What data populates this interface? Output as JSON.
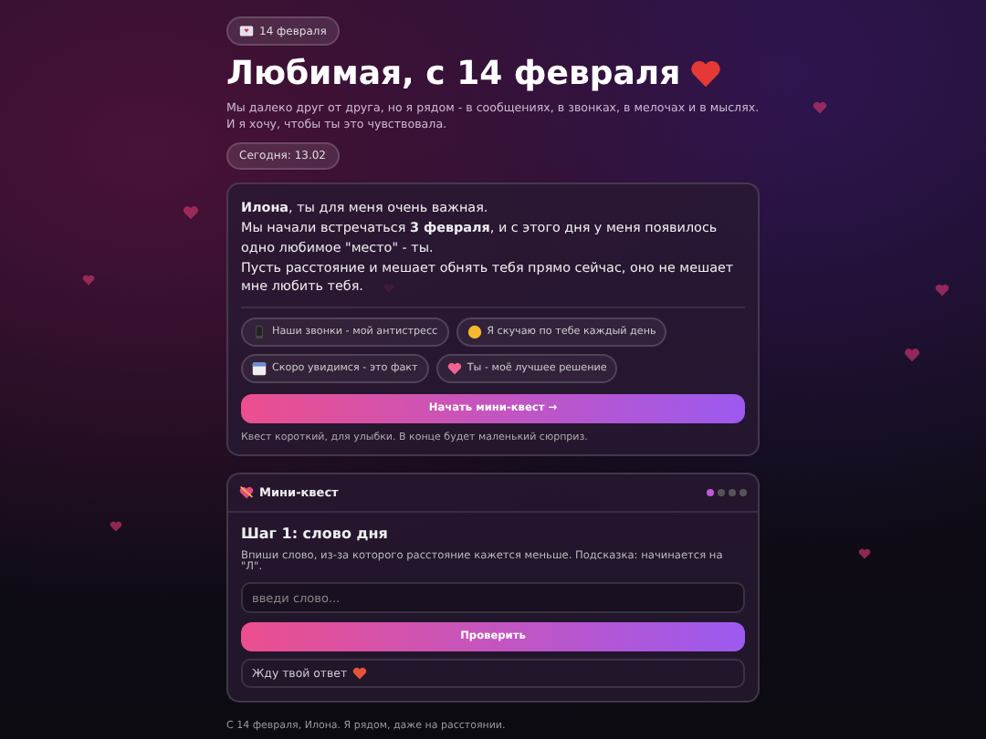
{
  "date_badge": "14 февраля",
  "title": "Любимая, с 14 февраля",
  "subtitle": "Мы далеко друг от друга, но я рядом - в сообщениях, в звонках, в мелочах и в мыслях. И я хочу, чтобы ты это чувствовала.",
  "today_badge": "Сегодня: 13.02",
  "message": [
    "**Илона**, ты для меня очень важная.",
    "Мы начали встречаться **3 февраля**, и с этого дня у меня появилось одно любимое \"место\" - ты.",
    "Пусть расстояние и мешает обнять тебя прямо сейчас, оно не мешает мне любить тебя."
  ],
  "chips": [
    {
      "kind": "phone",
      "label": "Наши звонки - мой антистресс"
    },
    {
      "kind": "face",
      "label": "Я скучаю по тебе каждый день"
    },
    {
      "kind": "calendar",
      "label": "Скоро увидимся - это факт"
    },
    {
      "kind": "heart",
      "label": "Ты - моё лучшее решение"
    }
  ],
  "start_button": "Начать мини-квест →",
  "start_note": "Квест короткий, для улыбки. В конце будет маленький сюрприз.",
  "quest": {
    "title": "Мини-квест",
    "progress_dots": [
      {
        "selected": true
      },
      {
        "selected": false
      },
      {
        "selected": false
      },
      {
        "selected": false
      }
    ],
    "step_title": "Шаг 1: слово дня",
    "step_text": "Впиши слово, из-за которого расстояние кажется меньше. Подсказка: начинается на \"Л\".",
    "input": {
      "placeholder": "введи слово..."
    },
    "check_button": "Проверить",
    "status": "Жду твой ответ"
  },
  "footer": "С 14 февраля, Илона. Я рядом, даже на расстоянии."
}
